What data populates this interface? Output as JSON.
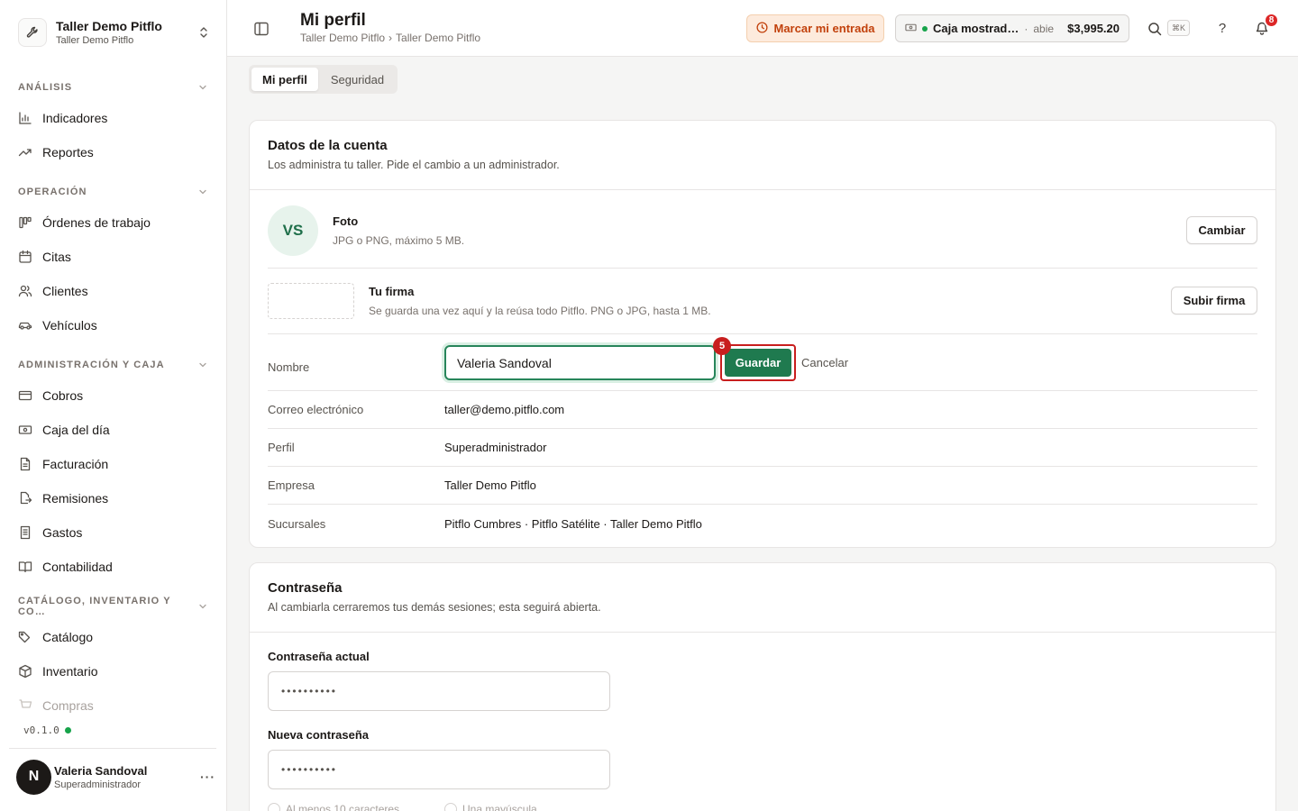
{
  "brand": {
    "name": "Taller Demo Pitflo",
    "sub": "Taller Demo Pitflo"
  },
  "sidebar": {
    "sections": [
      {
        "title": "ANÁLISIS",
        "items": [
          {
            "label": "Indicadores",
            "icon": "bar-chart-icon"
          },
          {
            "label": "Reportes",
            "icon": "trending-up-icon"
          }
        ]
      },
      {
        "title": "OPERACIÓN",
        "items": [
          {
            "label": "Órdenes de trabajo",
            "icon": "kanban-icon"
          },
          {
            "label": "Citas",
            "icon": "calendar-icon"
          },
          {
            "label": "Clientes",
            "icon": "users-icon"
          },
          {
            "label": "Vehículos",
            "icon": "car-icon"
          }
        ]
      },
      {
        "title": "ADMINISTRACIÓN Y CAJA",
        "items": [
          {
            "label": "Cobros",
            "icon": "credit-card-icon"
          },
          {
            "label": "Caja del día",
            "icon": "banknote-icon"
          },
          {
            "label": "Facturación",
            "icon": "file-text-icon"
          },
          {
            "label": "Remisiones",
            "icon": "file-export-icon"
          },
          {
            "label": "Gastos",
            "icon": "receipt-icon"
          },
          {
            "label": "Contabilidad",
            "icon": "book-open-icon"
          }
        ]
      },
      {
        "title": "CATÁLOGO, INVENTARIO Y CO…",
        "items": [
          {
            "label": "Catálogo",
            "icon": "tags-icon"
          },
          {
            "label": "Inventario",
            "icon": "package-icon"
          },
          {
            "label": "Compras",
            "icon": "cart-icon"
          }
        ]
      }
    ],
    "version": "v0.1.0",
    "user": {
      "initial": "N",
      "name": "Valeria Sandoval",
      "role": "Superadministrador",
      "more": "···"
    }
  },
  "header": {
    "title": "Mi perfil",
    "breadcrumb": [
      "Taller Demo Pitflo",
      "›",
      "Taller Demo Pitflo"
    ],
    "checkin_label": "Marcar mi entrada",
    "cash": {
      "name": "Caja mostrad…",
      "sep": "·",
      "status": "abie",
      "amount": "$3,995.20"
    },
    "kbd": "⌘K",
    "help": "?",
    "notifications": "8"
  },
  "tabs": [
    {
      "label": "Mi perfil",
      "active": true
    },
    {
      "label": "Seguridad",
      "active": false
    }
  ],
  "account": {
    "title": "Datos de la cuenta",
    "desc": "Los administra tu taller. Pide el cambio a un administrador.",
    "photo": {
      "initials": "VS",
      "title": "Foto",
      "desc": "JPG o PNG, máximo 5 MB.",
      "button": "Cambiar"
    },
    "signature": {
      "title": "Tu firma",
      "desc": "Se guarda una vez aquí y la reúsa todo Pitflo. PNG o JPG, hasta 1 MB.",
      "button": "Subir firma"
    },
    "name": {
      "label": "Nombre",
      "value": "Valeria Sandoval",
      "save": "Guardar",
      "cancel": "Cancelar",
      "step": "5"
    },
    "fields": [
      {
        "label": "Correo electrónico",
        "value": "taller@demo.pitflo.com"
      },
      {
        "label": "Perfil",
        "value": "Superadministrador"
      },
      {
        "label": "Empresa",
        "value": "Taller Demo Pitflo"
      },
      {
        "label": "Sucursales",
        "value": "Pitflo Cumbres · Pitflo Satélite · Taller Demo Pitflo"
      }
    ]
  },
  "password": {
    "title": "Contraseña",
    "desc": "Al cambiarla cerraremos tus demás sesiones; esta seguirá abierta.",
    "current_label": "Contraseña actual",
    "current_value": "••••••••••",
    "new_label": "Nueva contraseña",
    "new_value": "••••••••••",
    "requirements": [
      "Al menos 10 caracteres",
      "Una mayúscula"
    ]
  },
  "colors": {
    "accent": "#1f7a4f",
    "highlight": "#c81e1e",
    "checkin": "#c2410c"
  }
}
